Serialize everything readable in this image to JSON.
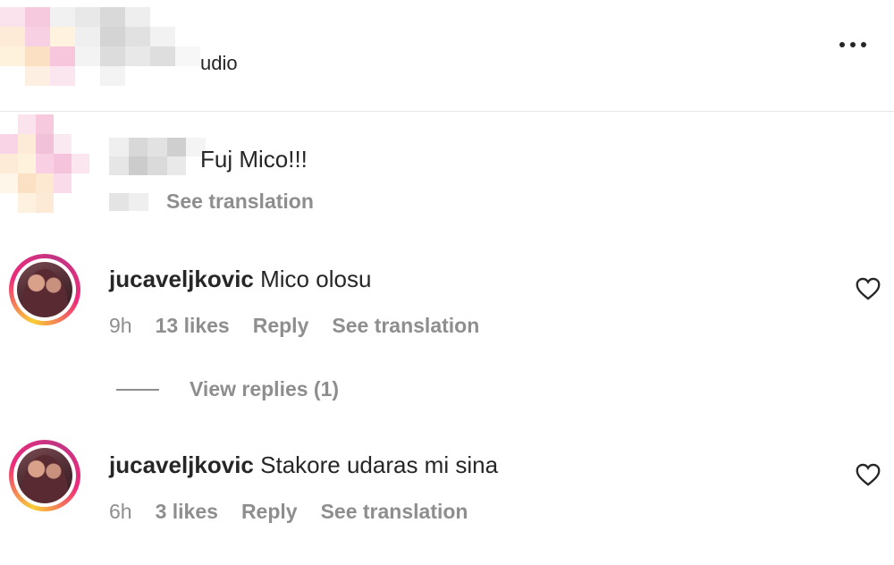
{
  "header": {
    "title_fragment": "udio",
    "more_icon": "more-horizontal-icon"
  },
  "caption": {
    "text_fragment": "Fuj Mico!!!",
    "see_translation": "See translation"
  },
  "comments": [
    {
      "username": "jucaveljkovic",
      "text": "Mico olosu",
      "time": "9h",
      "likes": "13 likes",
      "reply": "Reply",
      "see_translation": "See translation",
      "view_replies": "View replies (1)"
    },
    {
      "username": "jucaveljkovic",
      "text": "Stakore udaras mi sina",
      "time": "6h",
      "likes": "3 likes",
      "reply": "Reply",
      "see_translation": "See translation"
    }
  ],
  "colors": {
    "text": "#262626",
    "secondary": "#8e8e8e",
    "divider": "#e6e6e6",
    "story_ring_start": "#f9ce34",
    "story_ring_end": "#ee2a7b"
  }
}
